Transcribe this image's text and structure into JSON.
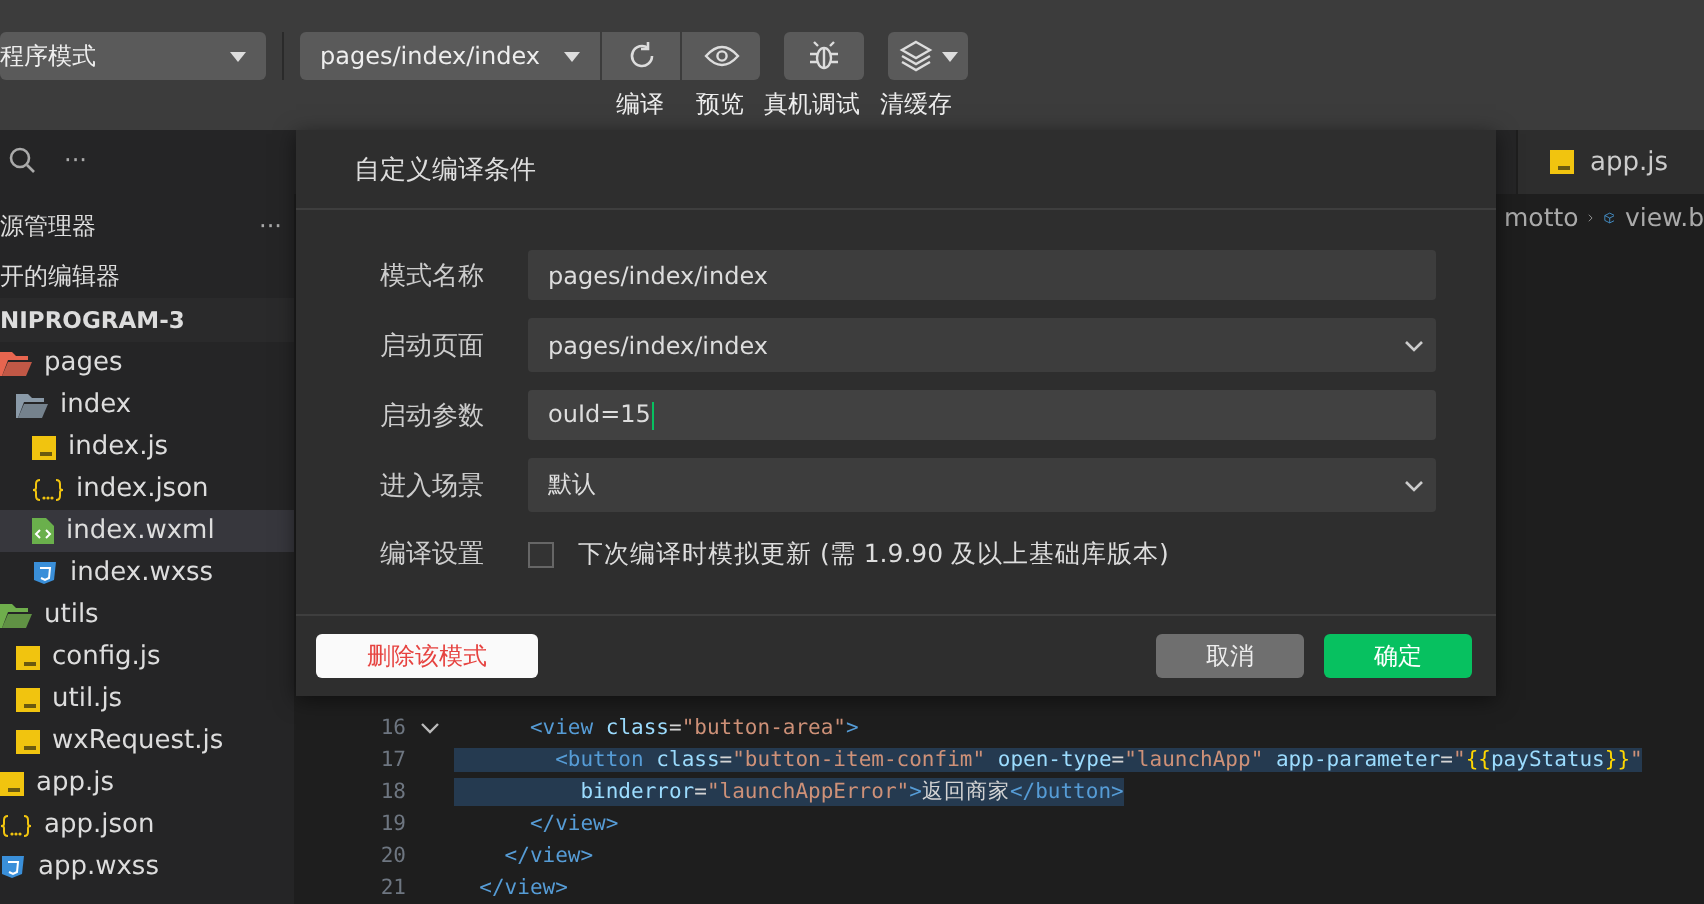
{
  "toolbar": {
    "mode_select": {
      "value": "程序模式"
    },
    "page_select": {
      "value": "pages/index/index"
    },
    "tools": [
      {
        "kind": "compile",
        "label": "编译"
      },
      {
        "kind": "preview",
        "label": "预览"
      },
      {
        "kind": "debug",
        "label": "真机调试"
      },
      {
        "kind": "cache",
        "label": "清缓存"
      }
    ]
  },
  "sidebar": {
    "title": "源管理器",
    "more": "···",
    "search_more": "···",
    "open_editors": "开的编辑器",
    "project": "NIPROGRAM-3",
    "tree": [
      {
        "name": "pages",
        "kind": "folder",
        "color": "#e8654f",
        "expanded": true,
        "selected": false,
        "children": [
          {
            "name": "index",
            "kind": "folder",
            "color": "#8a9aa8",
            "expanded": true,
            "selected": false,
            "children": [
              {
                "name": "index.js",
                "kind": "js",
                "selected": false
              },
              {
                "name": "index.json",
                "kind": "json",
                "selected": false
              },
              {
                "name": "index.wxml",
                "kind": "wxml",
                "selected": true
              },
              {
                "name": "index.wxss",
                "kind": "wxss",
                "selected": false
              }
            ]
          }
        ]
      },
      {
        "name": "utils",
        "kind": "folder",
        "color": "#6fae4c",
        "expanded": true,
        "selected": false,
        "children": [
          {
            "name": "config.js",
            "kind": "js",
            "selected": false
          },
          {
            "name": "util.js",
            "kind": "js",
            "selected": false
          },
          {
            "name": "wxRequest.js",
            "kind": "js",
            "selected": false
          }
        ]
      },
      {
        "name": "app.js",
        "kind": "js",
        "selected": false
      },
      {
        "name": "app.json",
        "kind": "json",
        "selected": false
      },
      {
        "name": "app.wxss",
        "kind": "wxss",
        "selected": false
      }
    ]
  },
  "editor": {
    "tab": {
      "label": "app.js",
      "kind": "js"
    },
    "breadcrumb": [
      "motto",
      "view.b"
    ],
    "lines": [
      {
        "number": "16",
        "text": "      <view class=\"button-area\">",
        "foldable": true,
        "highlighted": false
      },
      {
        "number": "17",
        "text": "        <button class=\"button-item-confim\" open-type=\"launchApp\" app-parameter=\"{{payStatus}}\"",
        "foldable": false,
        "highlighted": true
      },
      {
        "number": "18",
        "text": "          binderror=\"launchAppError\">返回商家</button>",
        "foldable": false,
        "highlighted": true
      },
      {
        "number": "19",
        "text": "      </view>",
        "foldable": false,
        "highlighted": false
      },
      {
        "number": "20",
        "text": "    </view>",
        "foldable": false,
        "highlighted": false
      },
      {
        "number": "21",
        "text": "  </view>",
        "foldable": false,
        "highlighted": false
      }
    ]
  },
  "dialog": {
    "title": "自定义编译条件",
    "fields": [
      {
        "label": "模式名称",
        "kind": "input",
        "value": "pages/index/index",
        "focused": false
      },
      {
        "label": "启动页面",
        "kind": "select",
        "value": "pages/index/index"
      },
      {
        "label": "启动参数",
        "kind": "input",
        "value": "ouId=15",
        "focused": true
      },
      {
        "label": "进入场景",
        "kind": "select",
        "value": "默认"
      }
    ],
    "compile_setting": {
      "label": "编译设置",
      "option": "下次编译时模拟更新 (需 1.9.90 及以上基础库版本)",
      "checked": false
    },
    "buttons": [
      {
        "label": "删除该模式",
        "kind": "danger"
      },
      {
        "label": "取消",
        "kind": "cancel"
      },
      {
        "label": "确定",
        "kind": "confirm"
      }
    ]
  }
}
